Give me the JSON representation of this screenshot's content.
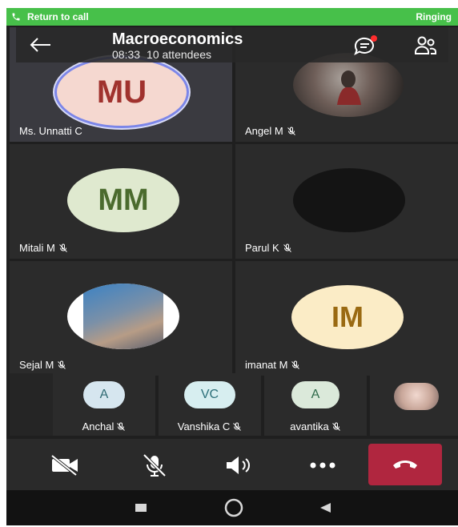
{
  "status_bar": {
    "return_label": "Return to call",
    "state": "Ringing"
  },
  "header": {
    "title": "Macroeconomics",
    "duration": "08:33",
    "attendees": "10 attendees"
  },
  "tiles": [
    {
      "name": "Ms. Unnatti C",
      "initials": "MU",
      "muted": false
    },
    {
      "name": "Angel M",
      "muted": true
    },
    {
      "name": "Mitali M",
      "initials": "MM",
      "muted": true
    },
    {
      "name": "Parul K",
      "muted": true
    },
    {
      "name": "Sejal M",
      "muted": true
    },
    {
      "name": "imanat M",
      "initials": "IM",
      "muted": true
    }
  ],
  "strip": [
    {
      "name": "Anchal",
      "initials": "A"
    },
    {
      "name": "Vanshika C",
      "initials": "VC"
    },
    {
      "name": "avantika",
      "initials": "A"
    }
  ],
  "colors": {
    "status_green": "#47c04a",
    "hangup_red": "#b0263f",
    "chat_badge": "#ff2d2d"
  },
  "controls": [
    "camera-off-icon",
    "mic-off-icon",
    "speaker-icon",
    "more-icon",
    "hangup-icon"
  ],
  "navigation": [
    "recents-icon",
    "home-icon",
    "back-icon"
  ]
}
